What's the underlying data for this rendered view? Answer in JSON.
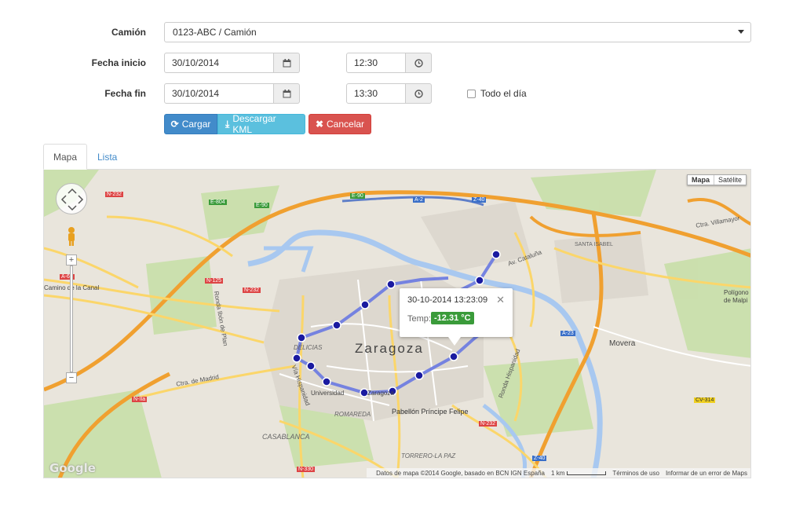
{
  "form": {
    "truck_label": "Camión",
    "truck_value": "0123-ABC / Camión",
    "start_label": "Fecha inicio",
    "start_date": "30/10/2014",
    "start_time": "12:30",
    "end_label": "Fecha fin",
    "end_date": "30/10/2014",
    "end_time": "13:30",
    "all_day_label": "Todo el día"
  },
  "buttons": {
    "load": "Cargar",
    "download": "Descargar KML",
    "cancel": "Cancelar"
  },
  "tabs": [
    {
      "label": "Mapa",
      "active": true
    },
    {
      "label": "Lista",
      "active": false
    }
  ],
  "map": {
    "type_map": "Mapa",
    "type_satellite": "Satélite",
    "city_label": "Zaragoza",
    "popup": {
      "title": "30-10-2014 13:23:09",
      "temp_label": "Temp:",
      "temp_value": "-12.31 °C"
    },
    "labels": {
      "delicias": "DELICIAS",
      "romareda": "ROMAREDA",
      "casablanca": "CASABLANCA",
      "torrero": "TORRERO-LA PAZ",
      "movera": "Movera",
      "santa_isabel": "SANTA ISABEL",
      "pabellon": "Pabellón Príncipe Felipe",
      "universidad": "Universidad",
      "zaragoza_station": "Zaragoza",
      "camino_canal": "Camino de la Canal",
      "poligono": "Polígono",
      "malpica": "de Malpi",
      "ctra_madrid": "Ctra. de Madrid",
      "ctra_villamayor": "Ctra. Villamayor",
      "av_cataluna": "Av. Cataluña",
      "ronda_hispanidad": "Ronda Hispanidad",
      "via_hispanidad": "Vía Hispanidad",
      "ronda_ibon": "Ronda Ibón de Plan"
    },
    "roads": [
      "N-232",
      "E-804",
      "E-90",
      "A-2",
      "Z-40",
      "E-90",
      "N-125",
      "N-232",
      "N-IIa",
      "A-23",
      "CV-314",
      "N-330",
      "N-232",
      "Z-40",
      "A-68"
    ],
    "attribution": "Datos de mapa ©2014 Google, basado en BCN IGN España",
    "scale": "1 km",
    "terms": "Términos de uso",
    "report": "Informar de un error de Maps",
    "google": "Google",
    "route_color": "#6f7de0",
    "marker_color": "#1a1aa0"
  },
  "colors": {
    "primary": "#428bca",
    "info": "#5bc0de",
    "danger": "#d9534f",
    "success": "#3a9b3a"
  }
}
